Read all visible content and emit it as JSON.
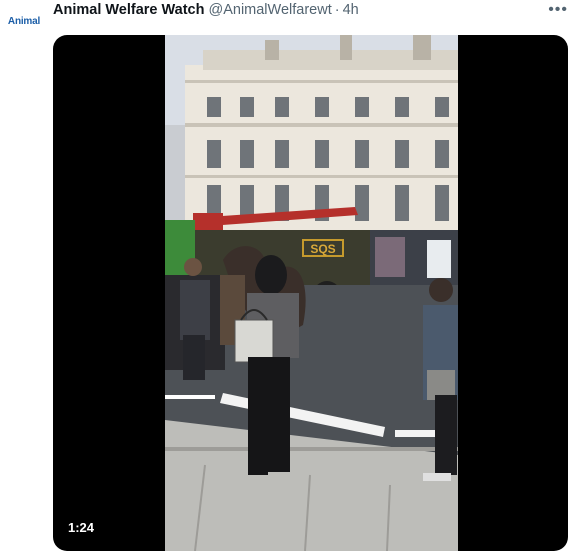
{
  "tweet": {
    "avatar_text": "Animal",
    "author": "Animal Welfare Watch",
    "handle": "@AnimalWelfarewt",
    "separator": "·",
    "time": "4h",
    "more_icon": "more-horizontal-icon",
    "media": {
      "duration": "1:24",
      "truck_text": "SQS"
    }
  },
  "colors": {
    "text_primary": "#0f1419",
    "text_secondary": "#536471",
    "media_bg": "#000000"
  }
}
